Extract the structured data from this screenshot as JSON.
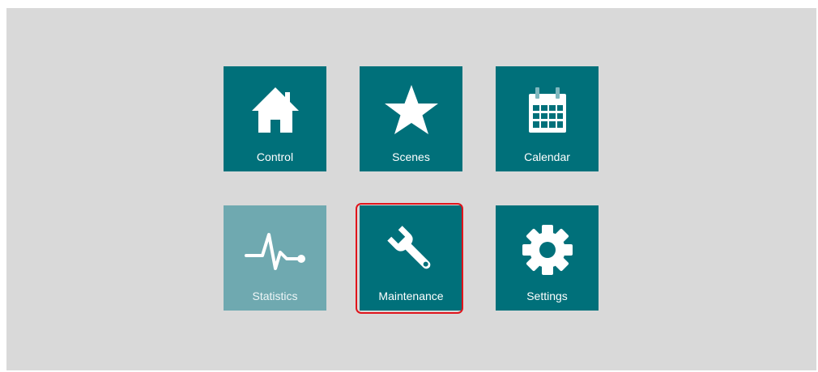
{
  "menu": {
    "tiles": [
      {
        "label": "Control",
        "icon": "house-icon",
        "enabled": true
      },
      {
        "label": "Scenes",
        "icon": "star-icon",
        "enabled": true
      },
      {
        "label": "Calendar",
        "icon": "calendar-icon",
        "enabled": true
      },
      {
        "label": "Statistics",
        "icon": "pulse-graph-icon",
        "enabled": false
      },
      {
        "label": "Maintenance",
        "icon": "wrench-icon",
        "enabled": true,
        "highlighted": true
      },
      {
        "label": "Settings",
        "icon": "gear-icon",
        "enabled": true
      }
    ]
  },
  "colors": {
    "background": "#d9d9d9",
    "tile": "#00707a",
    "tile_disabled": "#6fa9b0",
    "highlight": "#e0141b",
    "icon": "#ffffff"
  }
}
